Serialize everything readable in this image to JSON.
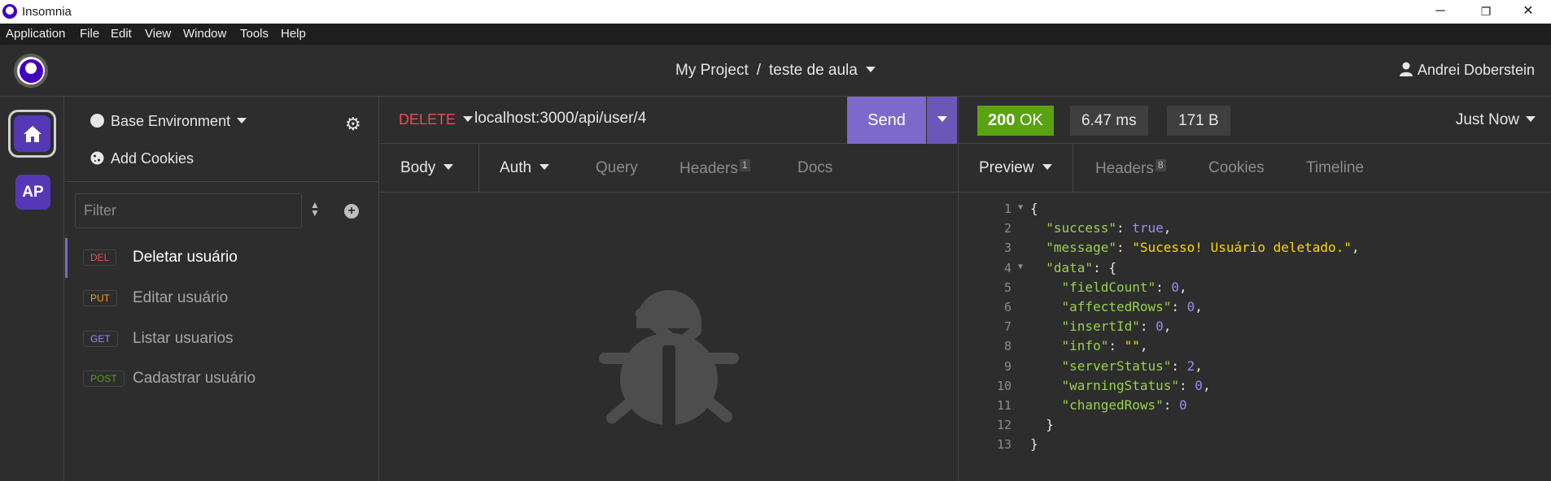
{
  "window": {
    "title": "Insomnia",
    "controls": [
      "─",
      "❐",
      "✕"
    ]
  },
  "menu": [
    "Application",
    "File",
    "Edit",
    "View",
    "Window",
    "Tools",
    "Help"
  ],
  "header": {
    "project": "My Project",
    "separator": "/",
    "document": "teste de aula",
    "user": "Andrei Doberstein"
  },
  "rail": {
    "workspace_initials": "AP"
  },
  "sidebar": {
    "environment": "Base Environment",
    "cookies": "Add Cookies",
    "filter_placeholder": "Filter",
    "requests": [
      {
        "method": "DEL",
        "color": "#e15251",
        "label": "Deletar usuário",
        "active": true
      },
      {
        "method": "PUT",
        "color": "#ff9a1f",
        "label": "Editar usuário",
        "active": false
      },
      {
        "method": "GET",
        "color": "#9e89f8",
        "label": "Listar usuarios",
        "active": false
      },
      {
        "method": "POST",
        "color": "#59a210",
        "label": "Cadastrar usuário",
        "active": false
      }
    ]
  },
  "request": {
    "method": "DELETE",
    "url": "localhost:3000/api/user/4",
    "send_label": "Send",
    "tabs": {
      "body": "Body",
      "auth": "Auth",
      "query": "Query",
      "headers": "Headers",
      "headers_count": "1",
      "docs": "Docs"
    }
  },
  "response": {
    "status_code": "200",
    "status_text": "OK",
    "time": "6.47 ms",
    "size": "171 B",
    "when": "Just Now",
    "tabs": {
      "preview": "Preview",
      "headers": "Headers",
      "headers_count": "8",
      "cookies": "Cookies",
      "timeline": "Timeline"
    },
    "lines": [
      {
        "n": "1",
        "fold": true,
        "html": "{"
      },
      {
        "n": "2",
        "fold": false,
        "html": "  <span class='k'>\"success\"</span>: <span class='n'>true</span>,"
      },
      {
        "n": "3",
        "fold": false,
        "html": "  <span class='k'>\"message\"</span>: <span class='s'>\"Sucesso! Usuário deletado.\"</span>,"
      },
      {
        "n": "4",
        "fold": true,
        "html": "  <span class='k'>\"data\"</span>: {"
      },
      {
        "n": "5",
        "fold": false,
        "html": "    <span class='k'>\"fieldCount\"</span>: <span class='n'>0</span>,"
      },
      {
        "n": "6",
        "fold": false,
        "html": "    <span class='k'>\"affectedRows\"</span>: <span class='n'>0</span>,"
      },
      {
        "n": "7",
        "fold": false,
        "html": "    <span class='k'>\"insertId\"</span>: <span class='n'>0</span>,"
      },
      {
        "n": "8",
        "fold": false,
        "html": "    <span class='k'>\"info\"</span>: <span class='s'>\"\"</span>,"
      },
      {
        "n": "9",
        "fold": false,
        "html": "    <span class='k'>\"serverStatus\"</span>: <span class='n'>2</span>,"
      },
      {
        "n": "10",
        "fold": false,
        "html": "    <span class='k'>\"warningStatus\"</span>: <span class='n'>0</span>,"
      },
      {
        "n": "11",
        "fold": false,
        "html": "    <span class='k'>\"changedRows\"</span>: <span class='n'>0</span>"
      },
      {
        "n": "12",
        "fold": false,
        "html": "  }"
      },
      {
        "n": "13",
        "fold": false,
        "html": "}"
      }
    ]
  }
}
